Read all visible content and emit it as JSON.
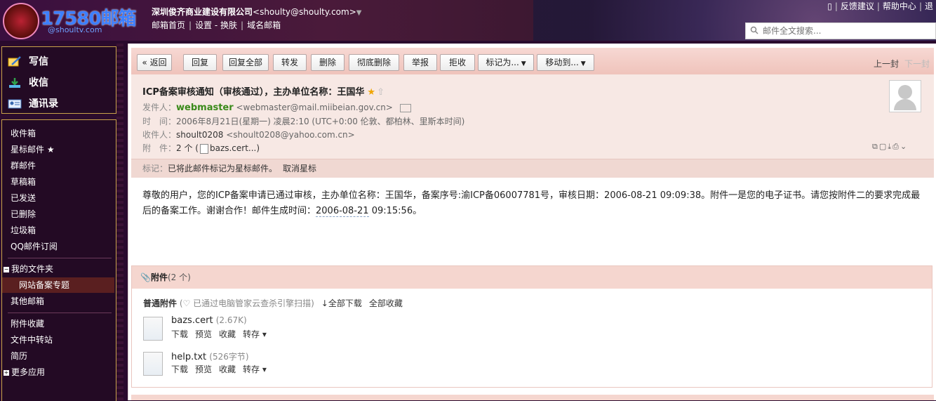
{
  "header": {
    "logo_text": "17580邮箱",
    "logo_sub": "@shoultv.com",
    "company": "深圳俊齐商业建设有限公司",
    "email": "<shoulty@shoulty.com>",
    "nav": [
      "邮箱首页",
      "设置 - 换肤",
      "域名邮箱"
    ],
    "top_links": [
      "反馈建议",
      "帮助中心",
      "退"
    ],
    "search_placeholder": "邮件全文搜索..."
  },
  "sidebar": {
    "compose": "写信",
    "inbox_check": "收信",
    "contacts": "通讯录",
    "folders": [
      "收件箱",
      "星标邮件 ★",
      "群邮件",
      "草稿箱",
      "已发送",
      "已删除",
      "垃圾箱",
      "QQ邮件订阅"
    ],
    "my_folders_label": "我的文件夹",
    "my_folders": [
      "网站备案专题"
    ],
    "other_mail": "其他邮箱",
    "extras": [
      "附件收藏",
      "文件中转站",
      "简历"
    ],
    "more_apps": "更多应用"
  },
  "toolbar": {
    "back": "« 返回",
    "reply": "回复",
    "reply_all": "回复全部",
    "forward": "转发",
    "delete": "删除",
    "delete_perm": "彻底删除",
    "report": "举报",
    "reject": "拒收",
    "mark_as": "标记为...",
    "move_to": "移动到...",
    "prev": "上一封",
    "next": "下一封"
  },
  "mail": {
    "subject": "ICP备案审核通知（审核通过），主办单位名称：王国华",
    "from_label": "发件人：",
    "from_name": "webmaster",
    "from_addr": "<webmaster@mail.miibeian.gov.cn>",
    "time_label": "时　间：",
    "time": "2006年8月21日(星期一) 凌晨2:10 (UTC+0:00 伦敦、都柏林、里斯本时间)",
    "to_label": "收件人：",
    "to_name": "shoult0208",
    "to_addr": "<shoult0208@yahoo.com.cn>",
    "att_label": "附　件：",
    "att_summary": "2 个 (",
    "att_first": "bazs.cert...)",
    "flag_label": "标记：",
    "flag_text": "已将此邮件标记为星标邮件。",
    "flag_cancel": "取消星标",
    "body_1": "尊敬的用户，您的ICP备案申请已通过审核，主办单位名称：王国华，备案序号:渝ICP备06007781号，审核日期：2006-08-21 09:09:38。附件一是您的电子证书。请您按附件二的要求完成最后的备案工作。谢谢合作！邮件生成时间：",
    "body_time": "2006-08-21",
    "body_time2": " 09:15:56。"
  },
  "attachments": {
    "title": "附件",
    "count": "(2 个)",
    "section": "普通附件",
    "scan_note": "(♡ 已通过电脑管家云查杀引擎扫描)",
    "download_all": "↓全部下载",
    "save_all": "全部收藏",
    "files": [
      {
        "name": "bazs.cert",
        "size": "(2.67K)",
        "actions": [
          "下载",
          "预览",
          "收藏",
          "转存 ▾"
        ]
      },
      {
        "name": "help.txt",
        "size": "(526字节)",
        "actions": [
          "下载",
          "预览",
          "收藏",
          "转存 ▾"
        ]
      }
    ]
  },
  "colors": {
    "sender_green": "#3a8a1a",
    "toolbar_pink": "#efc3bb",
    "sidebar_bg": "#230a24"
  }
}
